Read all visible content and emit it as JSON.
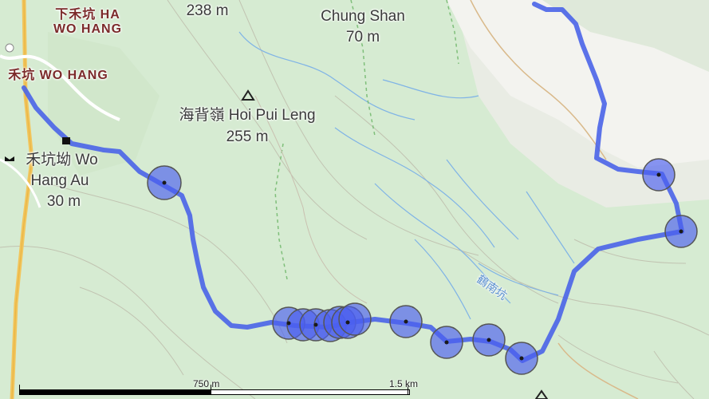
{
  "labels": {
    "top_elevation": "238 m",
    "top_right_peak_name": "Chung Shan",
    "top_right_peak_elev": "70 m",
    "ha_wo_hang_1": "下禾坑 HA",
    "ha_wo_hang_2": "WO HANG",
    "wo_hang": "禾坑 WO HANG",
    "hoi_pui_leng_name": "海背嶺 Hoi Pui Leng",
    "hoi_pui_leng_elev": "255 m",
    "wo_hang_au_name": "禾坑坳 Wo",
    "wo_hang_au_name2": "Hang Au",
    "wo_hang_au_elev": "30 m",
    "river_label": "鶴南坑"
  },
  "scale": {
    "label_mid": "750 m",
    "label_end": "1.5 km"
  },
  "colors": {
    "route": "#4a64e8",
    "marker_fill": "#4b5ff0",
    "park": "#d3ead0",
    "land": "#e8ebe3",
    "stream": "#7fb3e6",
    "road": "#f2c55c"
  },
  "icons": [
    "peak-icon",
    "building-icon",
    "pass-icon"
  ]
}
